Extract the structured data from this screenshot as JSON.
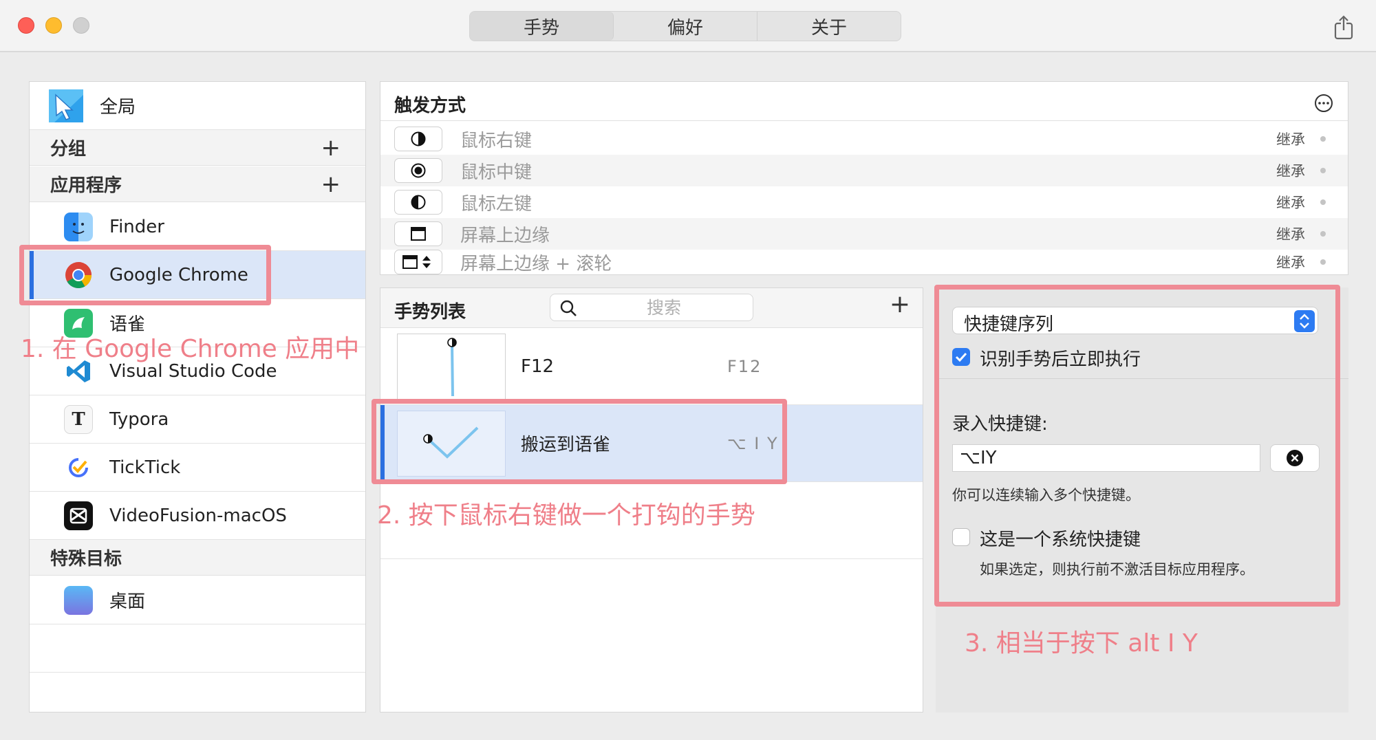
{
  "tabs": [
    {
      "label": "手势",
      "active": true
    },
    {
      "label": "偏好",
      "active": false
    },
    {
      "label": "关于",
      "active": false
    }
  ],
  "sidebar": {
    "global": {
      "label": "全局"
    },
    "groups_header": "分组",
    "apps_header": "应用程序",
    "apps": [
      {
        "label": "Finder",
        "icon": "finder-icon"
      },
      {
        "label": "Google Chrome",
        "icon": "chrome-icon",
        "selected": true
      },
      {
        "label": "语雀",
        "icon": "yuque-icon"
      },
      {
        "label": "Visual Studio Code",
        "icon": "vscode-icon"
      },
      {
        "label": "Typora",
        "icon": "typora-icon"
      },
      {
        "label": "TickTick",
        "icon": "ticktick-icon"
      },
      {
        "label": "VideoFusion-macOS",
        "icon": "videofusion-icon"
      }
    ],
    "special_header": "特殊目标",
    "special": [
      {
        "label": "桌面",
        "icon": "desktop-icon"
      }
    ]
  },
  "trigger": {
    "title": "触发方式",
    "items": [
      {
        "label": "鼠标右键",
        "status": "继承",
        "icon": "right-mouse-icon"
      },
      {
        "label": "鼠标中键",
        "status": "继承",
        "icon": "middle-mouse-icon"
      },
      {
        "label": "鼠标左键",
        "status": "继承",
        "icon": "left-mouse-icon"
      },
      {
        "label": "屏幕上边缘",
        "status": "继承",
        "icon": "screen-top-edge-icon"
      },
      {
        "label": "屏幕上边缘 + 滚轮",
        "status": "继承",
        "icon": "screen-top-edge-scroll-icon"
      }
    ]
  },
  "gestures": {
    "title": "手势列表",
    "search_placeholder": "搜索",
    "items": [
      {
        "name": "F12",
        "keys": "F12",
        "selected": false
      },
      {
        "name": "搬运到语雀",
        "keys": "⌥ I Y",
        "selected": true
      }
    ]
  },
  "action": {
    "type": "快捷键序列",
    "execute_immediately": {
      "label": "识别手势后立即执行",
      "checked": true
    },
    "record_label": "录入快捷键:",
    "shortcut_value": "⌥IY",
    "hint": "你可以连续输入多个快捷键。",
    "system_shortcut": {
      "label": "这是一个系统快捷键",
      "checked": false
    },
    "system_hint": "如果选定，则执行前不激活目标应用程序。"
  },
  "annotations": [
    "1. 在 Google Chrome 应用中",
    "2. 按下鼠标右键做一个打钩的手势",
    "3. 相当于按下 alt I Y"
  ],
  "colors": {
    "accent": "#2b6fe0",
    "selection": "#dbe6f8",
    "annotation": "#ef8b95"
  }
}
